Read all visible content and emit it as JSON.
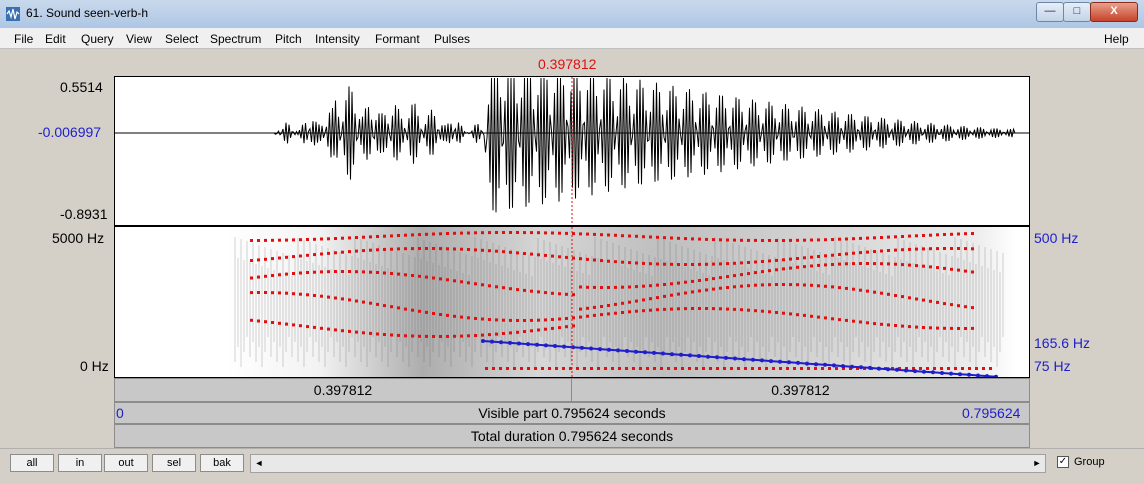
{
  "window": {
    "title": "61. Sound seen-verb-h",
    "buttons": {
      "minimize": "—",
      "maximize": "□",
      "close": "X"
    }
  },
  "menu": {
    "items": [
      "File",
      "Edit",
      "Query",
      "View",
      "Select",
      "Spectrum",
      "Pitch",
      "Intensity",
      "Formant",
      "Pulses"
    ],
    "help": "Help"
  },
  "waveform": {
    "cursor_time": "0.397812",
    "max": "0.5514",
    "zero": "-0.006997",
    "min": "-0.8931"
  },
  "spectrogram": {
    "top_freq": "5000 Hz",
    "bottom_freq": "0 Hz",
    "pitch_top": "500 Hz",
    "pitch_cursor": "165.6 Hz",
    "pitch_bottom": "75 Hz"
  },
  "timebars": {
    "left_segment": "0.397812",
    "right_segment": "0.397812",
    "visible_start": "0",
    "visible_label": "Visible part 0.795624 seconds",
    "visible_end": "0.795624",
    "total_label": "Total duration 0.795624 seconds"
  },
  "controls": {
    "buttons": [
      "all",
      "in",
      "out",
      "sel",
      "bak"
    ],
    "scroll_left": "◄",
    "scroll_right": "►",
    "group_label": "Group",
    "group_checked": true
  },
  "colors": {
    "cursor": "#e01010",
    "pitch": "#1e1ecc",
    "formant": "#e01010"
  }
}
